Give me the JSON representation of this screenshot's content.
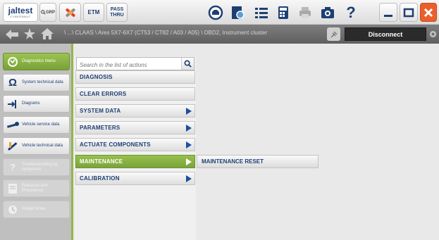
{
  "toolbar": {
    "logo_text": "jaltest",
    "logo_sub": "CYBERNAUT",
    "grp_label": "GRP",
    "etm_label": "ETM",
    "pass_label_1": "PASS",
    "pass_label_2": "THRU",
    "help_label": "?",
    "icons": [
      "jaltest-logo",
      "grp-search-icon",
      "tools-icon",
      "etm-button",
      "pass-thru-button",
      "engine-icon",
      "view-icon",
      "list-icon",
      "calculator-icon",
      "print-icon",
      "camera-icon",
      "help-icon",
      "minimize-icon",
      "maximize-icon",
      "close-icon"
    ],
    "colors": {
      "close": "#e9602c",
      "accent_green": "#8bb548",
      "brand_blue": "#1d3f73"
    }
  },
  "pathbar": {
    "path": "\\ ...\\ CLAAS \\ Ares 5X7-6X7 (CT53 / CT82 / A03 / A05) \\ DBD2, Instrument cluster",
    "disconnect_label": "Disconnect"
  },
  "sidebar": {
    "items": [
      {
        "label": "Diagnostics menu",
        "state": "active"
      },
      {
        "label": "System technical data",
        "state": "normal"
      },
      {
        "label": "Diagrams",
        "state": "normal"
      },
      {
        "label": "Vehicle service data",
        "state": "normal"
      },
      {
        "label": "Vehicle technical data",
        "state": "normal"
      },
      {
        "label": "Troubleshooting by symptoms",
        "state": "disabled"
      },
      {
        "label": "Releases and Procedures",
        "state": "disabled"
      },
      {
        "label": "Repair times",
        "state": "disabled"
      }
    ]
  },
  "search": {
    "placeholder": "Search in the list of actions"
  },
  "actions": {
    "items": [
      {
        "label": "DIAGNOSIS",
        "has_submenu": false
      },
      {
        "label": "CLEAR ERRORS",
        "has_submenu": false
      },
      {
        "label": "SYSTEM DATA",
        "has_submenu": true
      },
      {
        "label": "PARAMETERS",
        "has_submenu": true
      },
      {
        "label": "ACTUATE COMPONENTS",
        "has_submenu": true
      },
      {
        "label": "MAINTENANCE",
        "has_submenu": true,
        "selected": true
      },
      {
        "label": "CALIBRATION",
        "has_submenu": true
      }
    ]
  },
  "submenu": {
    "items": [
      {
        "label": "MAINTENANCE RESET"
      }
    ]
  }
}
